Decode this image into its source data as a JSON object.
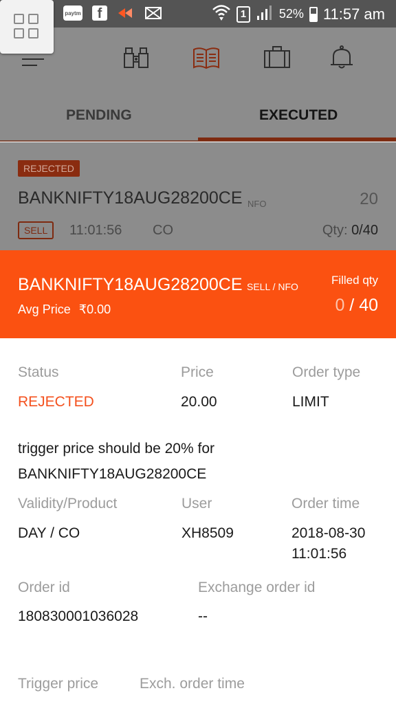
{
  "status_bar": {
    "paytm": "paytm",
    "fb": "f",
    "sim": "1",
    "battery": "52%",
    "time": "11:57 am"
  },
  "tabs": {
    "pending": "PENDING",
    "executed": "EXECUTED"
  },
  "order_row": {
    "status": "REJECTED",
    "symbol": "BANKNIFTY18AUG28200CE",
    "exchange": "NFO",
    "price": "20",
    "side": "SELL",
    "time": "11:01:56",
    "product": "CO",
    "qty_label": "Qty: ",
    "qty_value": "0/40"
  },
  "detail_header": {
    "symbol": "BANKNIFTY18AUG28200CE",
    "meta": "SELL / NFO",
    "avg_label": "Avg Price",
    "avg_value": "₹0.00",
    "filled_label": "Filled qty",
    "filled_done": "0",
    "filled_sep": " / ",
    "filled_total": "40"
  },
  "details": {
    "status_label": "Status",
    "status_value": "REJECTED",
    "price_label": "Price",
    "price_value": "20.00",
    "order_type_label": "Order type",
    "order_type_value": "LIMIT",
    "message_line1": "trigger price should be 20% for",
    "message_line2": "BANKNIFTY18AUG28200CE",
    "validity_label": "Validity/Product",
    "validity_value": "DAY / CO",
    "user_label": "User",
    "user_value": "XH8509",
    "order_time_label": "Order time",
    "order_time_date": "2018-08-30",
    "order_time_clock": "11:01:56",
    "order_id_label": "Order id",
    "order_id_value": "180830001036028",
    "exchange_order_id_label": "Exchange order id",
    "exchange_order_id_value": "--",
    "trigger_price_label": "Trigger price",
    "exch_order_time_label": "Exch. order time"
  },
  "colors": {
    "accent": "#fb5111",
    "status_rejected": "#f4511e",
    "overlay": "#8c8c8c"
  },
  "icons": [
    "menu-icon",
    "binoculars-icon",
    "book-icon",
    "briefcase-icon",
    "bell-icon",
    "launcher-icon"
  ]
}
